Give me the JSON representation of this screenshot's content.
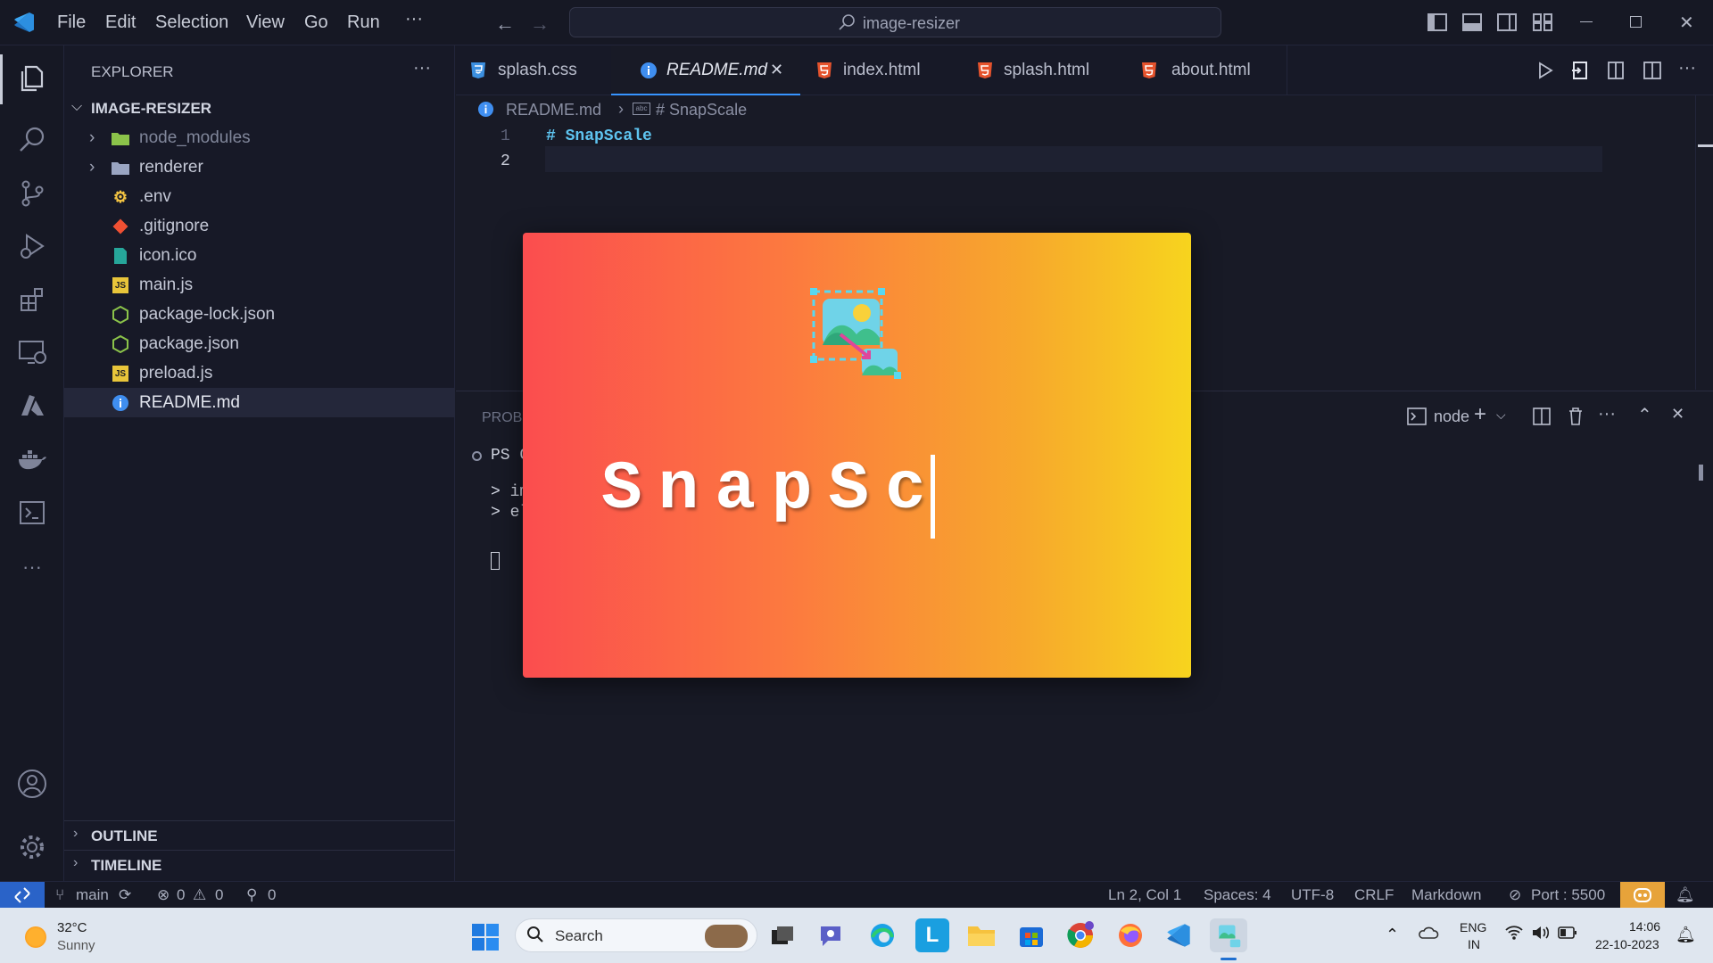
{
  "titlebar": {
    "menu": [
      "File",
      "Edit",
      "Selection",
      "View",
      "Go",
      "Run"
    ],
    "more": "···",
    "search_text": "image-resizer"
  },
  "activity_icons": [
    "explorer-icon",
    "search-icon",
    "source-control-icon",
    "run-debug-icon",
    "extensions-icon",
    "remote-explorer-icon",
    "azure-icon",
    "docker-icon",
    "terminal-icon",
    "more-icon",
    "accounts-icon",
    "manage-gear-icon"
  ],
  "sidebar": {
    "header": "EXPLORER",
    "more": "···",
    "project": "IMAGE-RESIZER",
    "items": [
      {
        "label": "node_modules",
        "type": "folder-node",
        "chevron": "›"
      },
      {
        "label": "renderer",
        "type": "folder",
        "chevron": "›"
      },
      {
        "label": ".env",
        "type": "env"
      },
      {
        "label": ".gitignore",
        "type": "git"
      },
      {
        "label": "icon.ico",
        "type": "image"
      },
      {
        "label": "main.js",
        "type": "js"
      },
      {
        "label": "package-lock.json",
        "type": "json"
      },
      {
        "label": "package.json",
        "type": "json"
      },
      {
        "label": "preload.js",
        "type": "js"
      },
      {
        "label": "README.md",
        "type": "info"
      }
    ],
    "outline": "OUTLINE",
    "timeline": "TIMELINE"
  },
  "tabs": [
    {
      "label": "splash.css"
    },
    {
      "label": "README.md",
      "active": true,
      "close": "✕"
    },
    {
      "label": "index.html"
    },
    {
      "label": "splash.html"
    },
    {
      "label": "about.html"
    }
  ],
  "breadcrumb": {
    "file": "README.md",
    "sep": "›",
    "symbol": "# SnapScale"
  },
  "editor": {
    "lines": [
      {
        "num": "1",
        "text": "# SnapScale"
      },
      {
        "num": "2",
        "text": ""
      }
    ]
  },
  "panel": {
    "tab_partial": "PROBL",
    "terminal_name": "node",
    "terminal_lines": [
      "PS C",
      "> im",
      "> el"
    ]
  },
  "splash": {
    "title": "SnapSc",
    "icon": "image-resize-icon"
  },
  "statusbar": {
    "branch": "main",
    "errors": "0",
    "warnings": "0",
    "ports": "0",
    "position": "Ln 2, Col 1",
    "spaces": "Spaces: 4",
    "encoding": "UTF-8",
    "eol": "CRLF",
    "language": "Markdown",
    "port": "Port : 5500"
  },
  "taskbar": {
    "weather_temp": "32°C",
    "weather_desc": "Sunny",
    "search_placeholder": "Search",
    "lang_top": "ENG",
    "lang_bottom": "IN",
    "time": "14:06",
    "date": "22-10-2023"
  },
  "colors": {
    "accent": "#3794ff",
    "splash_start": "#fb4d4f",
    "splash_end": "#f7d41e",
    "remote_badge": "#2a63c8",
    "copilot_badge": "#e7a33a"
  }
}
